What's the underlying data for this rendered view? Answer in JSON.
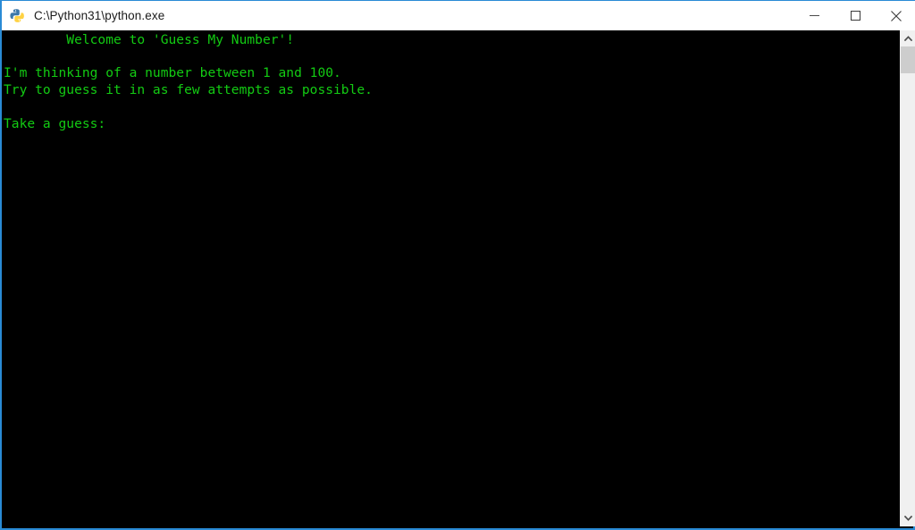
{
  "window": {
    "title": "C:\\Python31\\python.exe",
    "icon": "python-logo-icon",
    "border_color": "#2a8bd5",
    "titlebar_background": "#ffffff",
    "title_color": "#1a1a1a"
  },
  "controls": {
    "minimize_label": "Minimize",
    "maximize_label": "Maximize",
    "close_label": "Close"
  },
  "console": {
    "background": "#000000",
    "foreground": "#13cb13",
    "lines": [
      "        Welcome to 'Guess My Number'!",
      "",
      "I'm thinking of a number between 1 and 100.",
      "Try to guess it in as few attempts as possible.",
      "",
      "Take a guess:"
    ],
    "text": "        Welcome to 'Guess My Number'!\n\nI'm thinking of a number between 1 and 100.\nTry to guess it in as few attempts as possible.\n\nTake a guess:"
  },
  "scrollbar": {
    "up_arrow": "chevron-up-icon",
    "down_arrow": "chevron-down-icon",
    "track_color": "#f0f0f0",
    "thumb_color": "#cdcdcd"
  }
}
